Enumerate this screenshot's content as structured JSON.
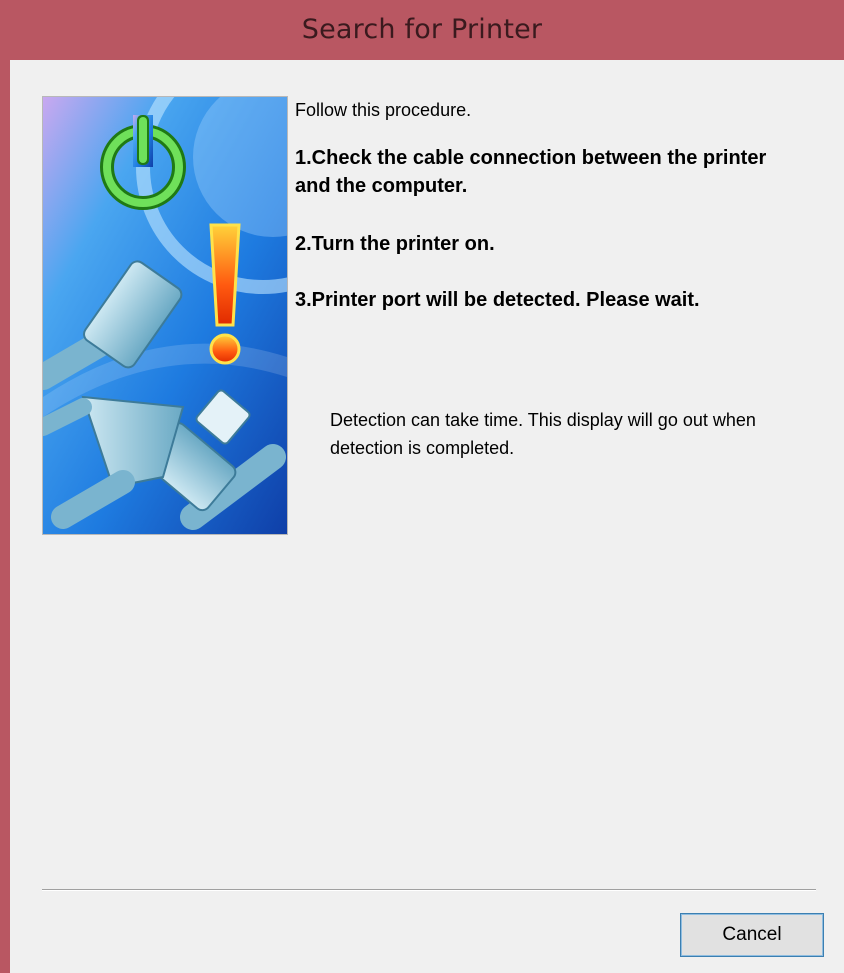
{
  "window": {
    "title": "Search for Printer"
  },
  "content": {
    "intro": "Follow this procedure.",
    "steps": [
      "1.Check the cable connection between the printer and the computer.",
      "2.Turn the printer on.",
      "3.Printer port will be detected. Please wait."
    ],
    "note": "Detection can take time. This display will go out when detection is completed."
  },
  "illustration": {
    "icons": [
      "power-icon",
      "exclamation-icon",
      "usb-cable-icon",
      "parallel-cable-icon"
    ]
  },
  "footer": {
    "cancel_label": "Cancel"
  },
  "colors": {
    "titlebar": "#b95762",
    "client_background": "#f0f0f0",
    "button_border": "#3c7fb1"
  }
}
